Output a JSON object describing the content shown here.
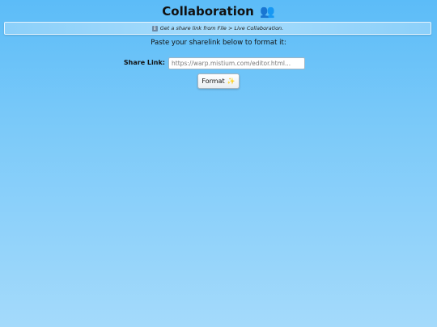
{
  "page": {
    "title": "Collaboration",
    "title_icon": "people-icon",
    "title_emoji": "👥"
  },
  "info_bar": {
    "icon": "info-icon",
    "icon_glyph": "i",
    "text": "Get a share link from File > Live Collaboration."
  },
  "instructions": "Paste your sharelink below to format it:",
  "share_link": {
    "label": "Share Link:",
    "placeholder": "https://warp.mistium.com/editor.html...",
    "value": ""
  },
  "format_button": {
    "label": "Format",
    "icon": "sparkles-icon",
    "icon_glyph": "✨"
  },
  "colors": {
    "background_top": "#5cbcf8",
    "background_bottom": "#a4dafb",
    "info_bar_bg": "#a6dcfc"
  }
}
